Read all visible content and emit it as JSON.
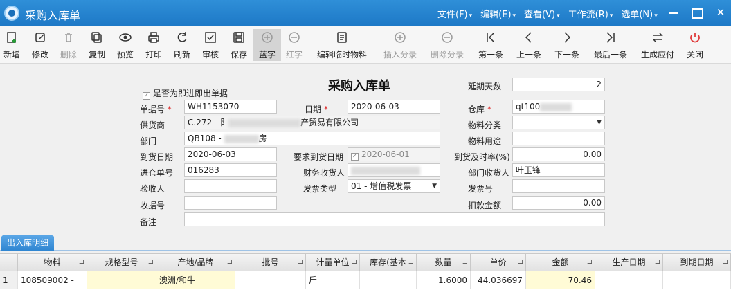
{
  "window": {
    "title": "采购入库单",
    "menus": [
      "文件(F)",
      "编辑(E)",
      "查看(V)",
      "工作流(R)",
      "选单(N)"
    ]
  },
  "toolbar": [
    {
      "label": "新增",
      "icon": "new-doc-icon",
      "state": "normal"
    },
    {
      "label": "修改",
      "icon": "edit-icon",
      "state": "normal"
    },
    {
      "label": "删除",
      "icon": "trash-icon",
      "state": "disabled"
    },
    {
      "label": "复制",
      "icon": "copy-icon",
      "state": "normal"
    },
    {
      "label": "预览",
      "icon": "eye-icon",
      "state": "normal"
    },
    {
      "label": "打印",
      "icon": "printer-icon",
      "state": "normal"
    },
    {
      "label": "刷新",
      "icon": "refresh-icon",
      "state": "normal"
    },
    {
      "label": "审核",
      "icon": "approve-icon",
      "state": "normal"
    },
    {
      "label": "保存",
      "icon": "save-icon",
      "state": "normal"
    },
    {
      "label": "蓝字",
      "icon": "plus-circle-icon",
      "state": "pressed"
    },
    {
      "label": "红字",
      "icon": "minus-circle-icon",
      "state": "disabled"
    },
    {
      "label": "编辑临时物料",
      "icon": "edit-list-icon",
      "state": "normal"
    },
    {
      "label": "插入分录",
      "icon": "plus-circle-icon",
      "state": "disabled"
    },
    {
      "label": "删除分录",
      "icon": "minus-circle-icon",
      "state": "disabled"
    },
    {
      "label": "第一条",
      "icon": "first-icon",
      "state": "normal"
    },
    {
      "label": "上一条",
      "icon": "prev-icon",
      "state": "normal"
    },
    {
      "label": "下一条",
      "icon": "next-icon",
      "state": "normal"
    },
    {
      "label": "最后一条",
      "icon": "last-icon",
      "state": "normal"
    },
    {
      "label": "生成应付",
      "icon": "transfer-icon",
      "state": "normal"
    },
    {
      "label": "关闭",
      "icon": "power-icon",
      "state": "normal"
    }
  ],
  "form": {
    "title": "采购入库单",
    "immediate_checkbox": "是否为即进即出单据",
    "delay_days": {
      "label": "延期天数",
      "value": "2"
    },
    "doc_no": {
      "label": "单据号",
      "value": "WH1153070"
    },
    "date": {
      "label": "日期",
      "value": "2020-06-03"
    },
    "warehouse": {
      "label": "仓库",
      "value": "qt100"
    },
    "supplier": {
      "label": "供货商",
      "value_prefix": "C.272 - 阝",
      "value_suffix": "产贸易有限公司"
    },
    "material_category": {
      "label": "物料分类",
      "value": ""
    },
    "department": {
      "label": "部门",
      "value_prefix": "QB108 - ",
      "value_suffix": "房"
    },
    "material_use": {
      "label": "物料用途",
      "value": ""
    },
    "arrival_date": {
      "label": "到货日期",
      "value": "2020-06-03"
    },
    "required_arrival_date": {
      "label": "要求到货日期",
      "value": "2020-06-01"
    },
    "arrival_timeliness": {
      "label": "到货及时率(%)",
      "value": "0.00"
    },
    "entry_no": {
      "label": "进仓单号",
      "value": "016283"
    },
    "finance_receiver": {
      "label": "财务收货人",
      "value": ""
    },
    "dept_receiver": {
      "label": "部门收货人",
      "value": "叶玉锋"
    },
    "inspector": {
      "label": "验收人",
      "value": ""
    },
    "invoice_type": {
      "label": "发票类型",
      "value": "01 - 增值税发票"
    },
    "invoice_no": {
      "label": "发票号",
      "value": ""
    },
    "receipt_no": {
      "label": "收据号",
      "value": ""
    },
    "deduction": {
      "label": "扣款金额",
      "value": "0.00"
    },
    "remark": {
      "label": "备注",
      "value": ""
    }
  },
  "details": {
    "tab_label": "出入库明细",
    "columns": [
      "物料",
      "规格型号",
      "产地/品牌",
      "批号",
      "计量单位",
      "库存(基本",
      "数量",
      "单价",
      "金额",
      "生产日期",
      "到期日期"
    ],
    "rows": [
      {
        "idx": "1",
        "material": "108509002 -",
        "spec": "",
        "origin": "澳洲/和牛",
        "batch": "",
        "unit": "斤",
        "stock": "",
        "qty": "1.6000",
        "price": "44.036697",
        "amount": "70.46",
        "mfg_date": "",
        "exp_date": ""
      }
    ]
  }
}
